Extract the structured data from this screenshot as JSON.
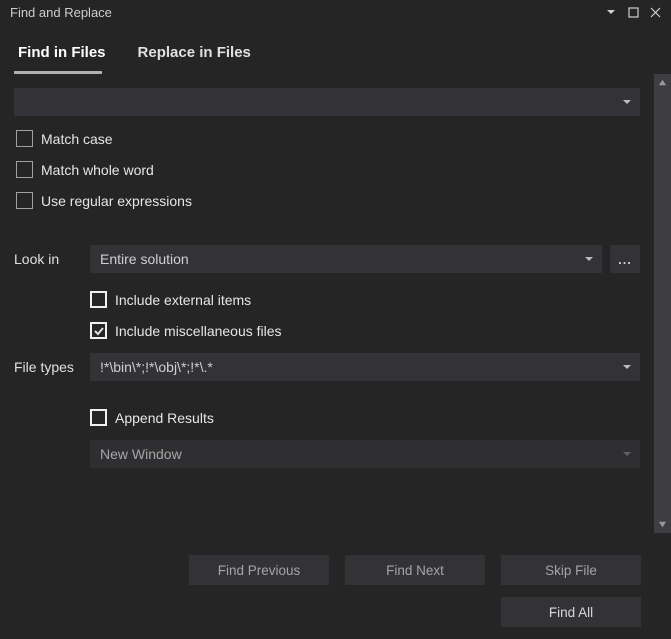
{
  "title": "Find and Replace",
  "tabs": {
    "find": "Find in Files",
    "replace": "Replace in Files"
  },
  "search": {
    "value": ""
  },
  "options": {
    "match_case": "Match case",
    "match_whole_word": "Match whole word",
    "use_regex": "Use regular expressions"
  },
  "lookin": {
    "label": "Look in",
    "value": "Entire solution",
    "browse": "...",
    "include_external": "Include external items",
    "include_misc": "Include miscellaneous files"
  },
  "filetypes": {
    "label": "File types",
    "value": "!*\\bin\\*;!*\\obj\\*;!*\\.*"
  },
  "results": {
    "append": "Append Results",
    "target": "New Window"
  },
  "buttons": {
    "find_previous": "Find Previous",
    "find_next": "Find Next",
    "skip_file": "Skip File",
    "find_all": "Find All"
  }
}
